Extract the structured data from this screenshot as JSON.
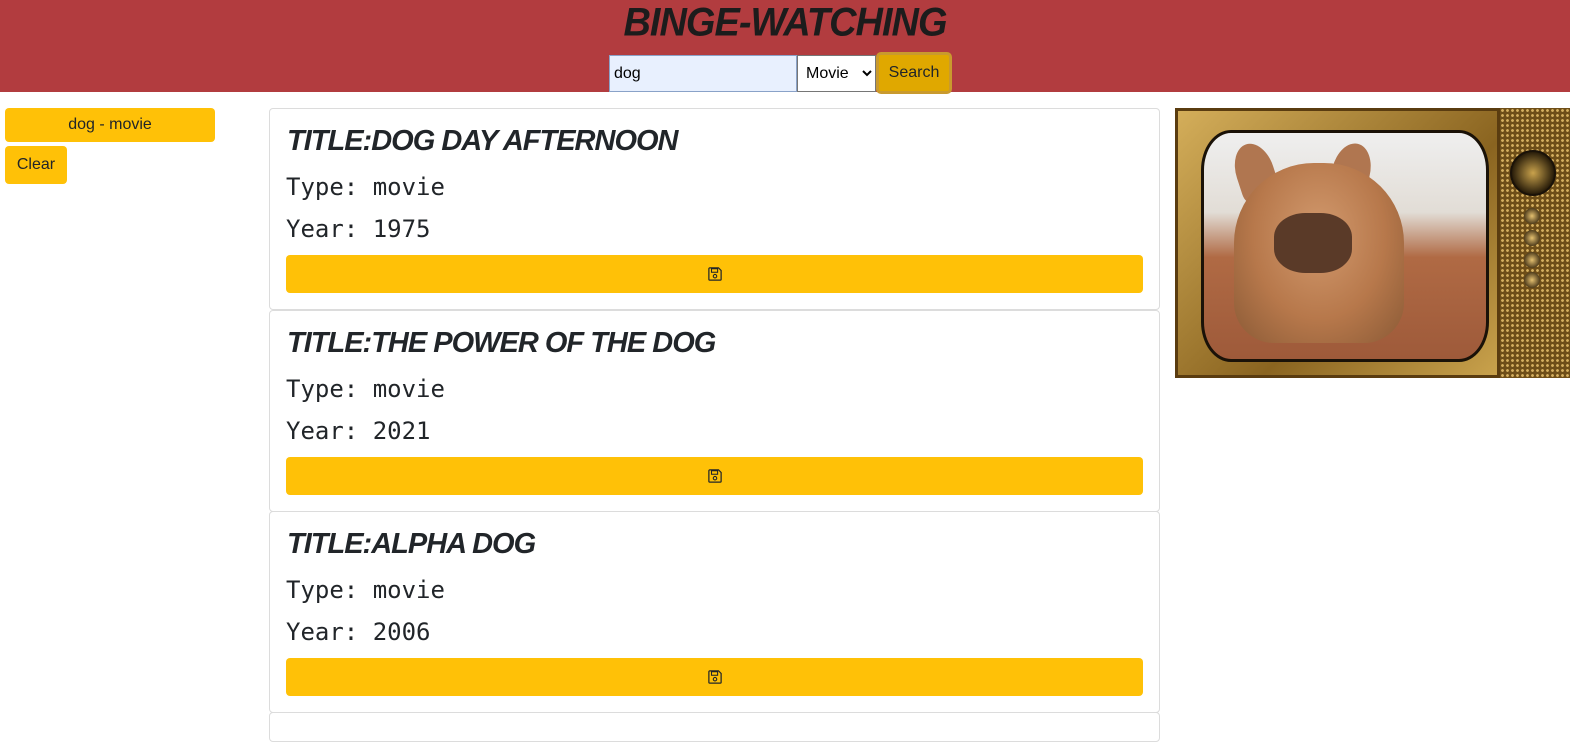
{
  "header": {
    "title": "Binge-Watching",
    "search_value": "dog",
    "type_options": [
      "Movie"
    ],
    "type_selected": "Movie",
    "search_label": "Search",
    "accent": "#b23c3f"
  },
  "sidebar": {
    "history": [
      "dog - movie"
    ],
    "clear_label": "Clear"
  },
  "results": [
    {
      "title": "Title:Dog Day Afternoon",
      "type": "Type: movie",
      "year": "Year: 1975"
    },
    {
      "title": "Title:The Power of the Dog",
      "type": "Type: movie",
      "year": "Year: 2021"
    },
    {
      "title": "Title:Alpha Dog",
      "type": "Type: movie",
      "year": "Year: 2006"
    }
  ],
  "icons": {
    "save": "floppy-disk-icon"
  },
  "colors": {
    "button": "#ffc107",
    "header": "#b23c3f"
  }
}
